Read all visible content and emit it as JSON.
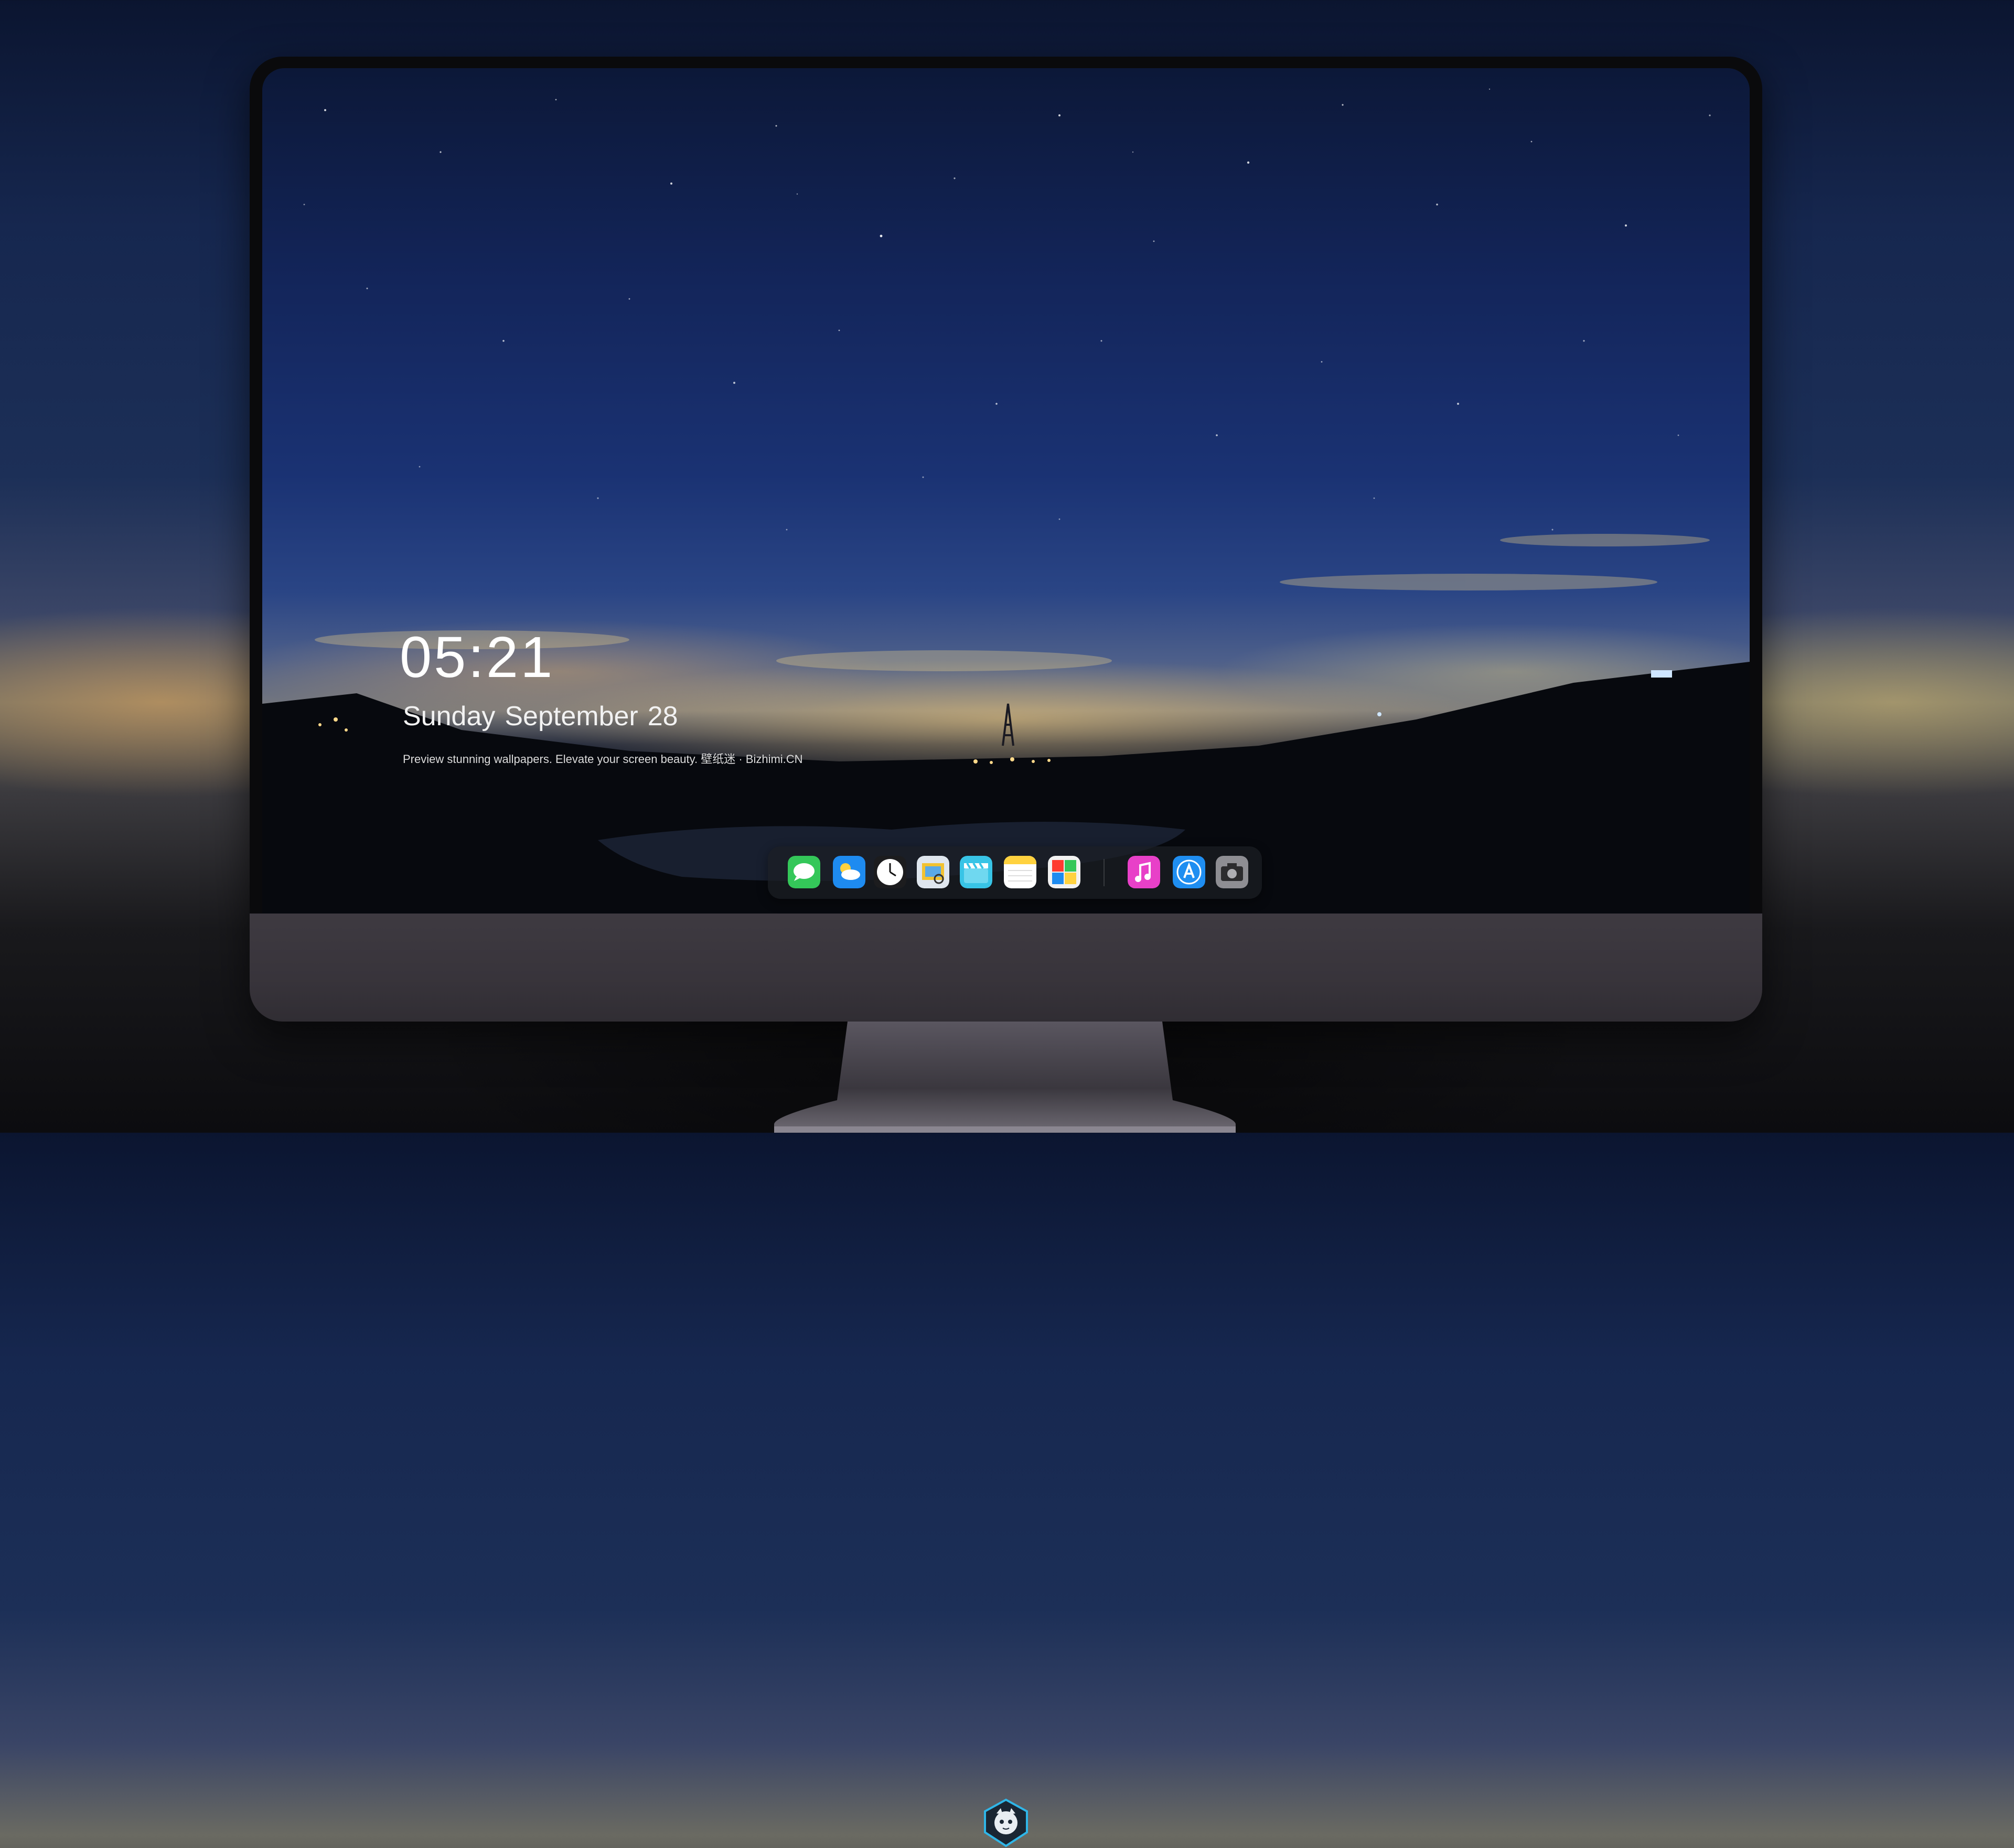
{
  "lock_screen": {
    "time": "05:21",
    "date_weekday": "Sunday",
    "date_month": "September",
    "date_day": "28",
    "tagline": "Preview stunning wallpapers. Elevate your screen beauty. 壁纸迷 · Bizhimi.CN"
  },
  "dock": {
    "apps": [
      {
        "name": "Messages",
        "icon": "messages-icon",
        "color": "#34c759"
      },
      {
        "name": "Weather",
        "icon": "weather-icon",
        "color": "#1e8bf0"
      },
      {
        "name": "Clock",
        "icon": "clock-icon",
        "color": "#ffffff"
      },
      {
        "name": "Preview",
        "icon": "preview-icon",
        "color": "#f2c230"
      },
      {
        "name": "Clips",
        "icon": "clips-icon",
        "color": "#38c4e6"
      },
      {
        "name": "Notes",
        "icon": "notes-icon",
        "color": "#ffd23f"
      },
      {
        "name": "Photo Booth",
        "icon": "photo-booth-icon",
        "color": "#ff3b30"
      },
      {
        "name": "iTunes",
        "icon": "itunes-icon",
        "color": "#e840c8"
      },
      {
        "name": "App Store",
        "icon": "app-store-icon",
        "color": "#1f8ef1"
      },
      {
        "name": "Camera",
        "icon": "camera-icon",
        "color": "#8e8e93"
      }
    ]
  },
  "brand": {
    "icon": "shield-mascot-icon",
    "accent": "#2fb6e8"
  }
}
